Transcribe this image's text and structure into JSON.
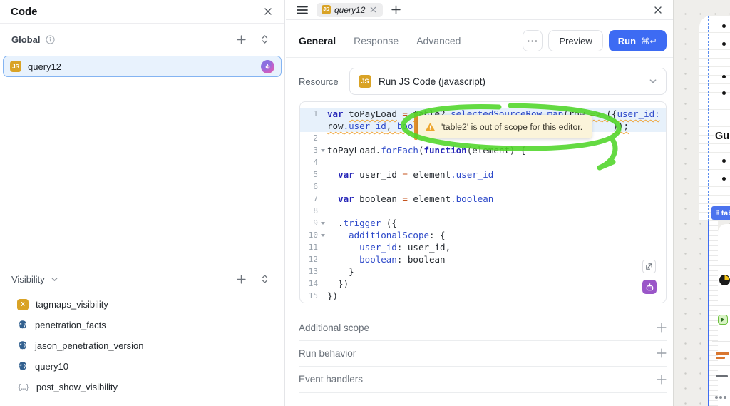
{
  "colors": {
    "accent_blue": "#3d6bf3",
    "selection_border": "#84b4f2",
    "selection_bg": "#e8f2fd",
    "js_gold": "#d9a326",
    "postgres_blue": "#32608f",
    "warning_orange": "#e2902c",
    "tooltip_bg": "#fbf4da",
    "marker_green": "#4fd628",
    "ai_purple": "#9a56c8",
    "tag_blue": "#4b73ee"
  },
  "icon_glyphs": {
    "js": "JS",
    "transformer": "X",
    "state": "{…}",
    "drag_dots": "⠿",
    "more": "···"
  },
  "sidebar": {
    "title": "Code",
    "global_section": {
      "label": "Global"
    },
    "selected_query": {
      "label": "query12",
      "icon": "js-icon"
    },
    "visibility_section": {
      "label": "Visibility"
    },
    "visibility_items": [
      {
        "label": "tagmaps_visibility",
        "icon": "transformer-icon"
      },
      {
        "label": "penetration_facts",
        "icon": "postgresql-icon"
      },
      {
        "label": "jason_penetration_version",
        "icon": "postgresql-icon"
      },
      {
        "label": "query10",
        "icon": "postgresql-icon"
      },
      {
        "label": "post_show_visibility",
        "icon": "state-icon"
      }
    ]
  },
  "editor": {
    "tab_label": "query12",
    "nav_tabs": [
      {
        "label": "General",
        "active": true
      },
      {
        "label": "Response",
        "active": false
      },
      {
        "label": "Advanced",
        "active": false
      }
    ],
    "preview_label": "Preview",
    "run_label": "Run",
    "run_shortcut": "⌘↵",
    "resource_label": "Resource",
    "resource_value": "Run JS Code (javascript)",
    "warning_text": "'table2' is out of scope for this editor.",
    "sections": [
      "Additional scope",
      "Run behavior",
      "Event handlers"
    ],
    "code_rows": [
      {
        "n": "1",
        "a": 1,
        "t": [
          [
            "kw",
            "var",
            0
          ],
          [
            "pl",
            " ",
            0
          ],
          [
            "pl",
            "toPayLoad",
            1
          ],
          [
            "pl",
            " ",
            0
          ],
          [
            "op",
            "=",
            0
          ],
          [
            "pl",
            " ",
            0
          ],
          [
            "pl",
            "table2.",
            1
          ],
          [
            "pr",
            "selectedSourceRow",
            1
          ],
          [
            "pl",
            ".",
            1
          ],
          [
            "pr",
            "map",
            1
          ],
          [
            "pl",
            "(row ",
            1
          ],
          [
            "op",
            "=>",
            1
          ],
          [
            "pl",
            " ({",
            1
          ],
          [
            "pr",
            "user_id:",
            1
          ]
        ]
      },
      {
        "n": "",
        "a": 1,
        "t": [
          [
            "pl",
            "row",
            1
          ],
          [
            "pr",
            ".user_id",
            1
          ],
          [
            "pl",
            ", ",
            1
          ],
          [
            "pr",
            "boo",
            1
          ]
        ],
        "gap": 1,
        "t2": [
          [
            "pl",
            "));",
            1
          ]
        ]
      },
      {
        "n": "2",
        "t": []
      },
      {
        "n": "3",
        "f": 1,
        "t": [
          [
            "pl",
            "toPayLoad.",
            0
          ],
          [
            "pr",
            "forEach",
            0
          ],
          [
            "pl",
            "(",
            0
          ],
          [
            "kw",
            "function",
            0
          ],
          [
            "pl",
            "(element) {",
            0
          ]
        ]
      },
      {
        "n": "4",
        "t": []
      },
      {
        "n": "5",
        "t": [
          [
            "pl",
            "  ",
            0
          ],
          [
            "kw",
            "var",
            0
          ],
          [
            "pl",
            " user_id ",
            0
          ],
          [
            "op",
            "=",
            0
          ],
          [
            "pl",
            " element",
            0
          ],
          [
            "pr",
            ".user_id",
            0
          ]
        ]
      },
      {
        "n": "6",
        "t": []
      },
      {
        "n": "7",
        "t": [
          [
            "pl",
            "  ",
            0
          ],
          [
            "kw",
            "var",
            0
          ],
          [
            "pl",
            " boolean ",
            0
          ],
          [
            "op",
            "=",
            0
          ],
          [
            "pl",
            " element",
            0
          ],
          [
            "pr",
            ".boolean",
            0
          ]
        ]
      },
      {
        "n": "8",
        "t": []
      },
      {
        "n": "9",
        "f": 1,
        "t": [
          [
            "pl",
            "  .",
            0
          ],
          [
            "pr",
            "trigger",
            0
          ],
          [
            "pl",
            " ({",
            0
          ]
        ]
      },
      {
        "n": "10",
        "f": 1,
        "t": [
          [
            "pl",
            "    ",
            0
          ],
          [
            "pr",
            "additionalScope",
            0
          ],
          [
            "pl",
            ": {",
            0
          ]
        ]
      },
      {
        "n": "11",
        "t": [
          [
            "pl",
            "      ",
            0
          ],
          [
            "pr",
            "user_id",
            0
          ],
          [
            "pl",
            ": user_id,",
            0
          ]
        ]
      },
      {
        "n": "12",
        "t": [
          [
            "pl",
            "      ",
            0
          ],
          [
            "pr",
            "boolean",
            0
          ],
          [
            "pl",
            ": boolean",
            0
          ]
        ]
      },
      {
        "n": "13",
        "t": [
          [
            "pl",
            "    }",
            0
          ]
        ]
      },
      {
        "n": "14",
        "t": [
          [
            "pl",
            "  })",
            0
          ]
        ]
      },
      {
        "n": "15",
        "t": [
          [
            "pl",
            "})",
            0
          ]
        ]
      }
    ]
  },
  "canvas": {
    "heading": "Gui",
    "component_tag": "tab"
  }
}
